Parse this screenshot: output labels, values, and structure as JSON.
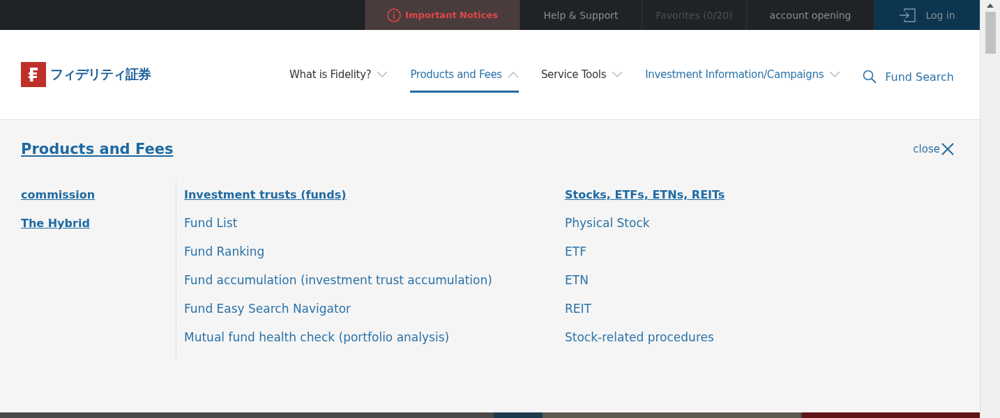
{
  "top_bar": [
    {
      "label": "Important Notices",
      "kind": "notice",
      "disabled": false
    },
    {
      "label": "Help & Support",
      "kind": "link",
      "disabled": false
    },
    {
      "label": "Favorites (0/20)",
      "kind": "link",
      "disabled": true
    },
    {
      "label": "account opening",
      "kind": "link",
      "disabled": false
    },
    {
      "label": "Log in",
      "kind": "login",
      "disabled": false
    }
  ],
  "logo": {
    "text": "フィデリティ証券"
  },
  "nav": [
    {
      "label": "What is Fidelity?",
      "expanded": false,
      "accent": false
    },
    {
      "label": "Products and Fees",
      "expanded": true,
      "accent": true
    },
    {
      "label": "Service Tools",
      "expanded": false,
      "accent": false
    },
    {
      "label": "Investment Information/Campaigns",
      "expanded": false,
      "accent": true
    }
  ],
  "fund_search": "Fund Search",
  "menu": {
    "title": "Products and Fees",
    "close": "close",
    "side_links": [
      "commission",
      "The Hybrid"
    ],
    "columns": [
      {
        "heading": "Investment trusts (funds)",
        "links": [
          "Fund List",
          "Fund Ranking",
          "Fund accumulation (investment trust accumulation)",
          "Fund Easy Search Navigator",
          "Mutual fund health check (portfolio analysis)"
        ]
      },
      {
        "heading": "Stocks, ETFs, ETNs, REITs",
        "links": [
          "Physical Stock",
          "ETF",
          "ETN",
          "REIT",
          "Stock-related procedures"
        ]
      }
    ]
  }
}
